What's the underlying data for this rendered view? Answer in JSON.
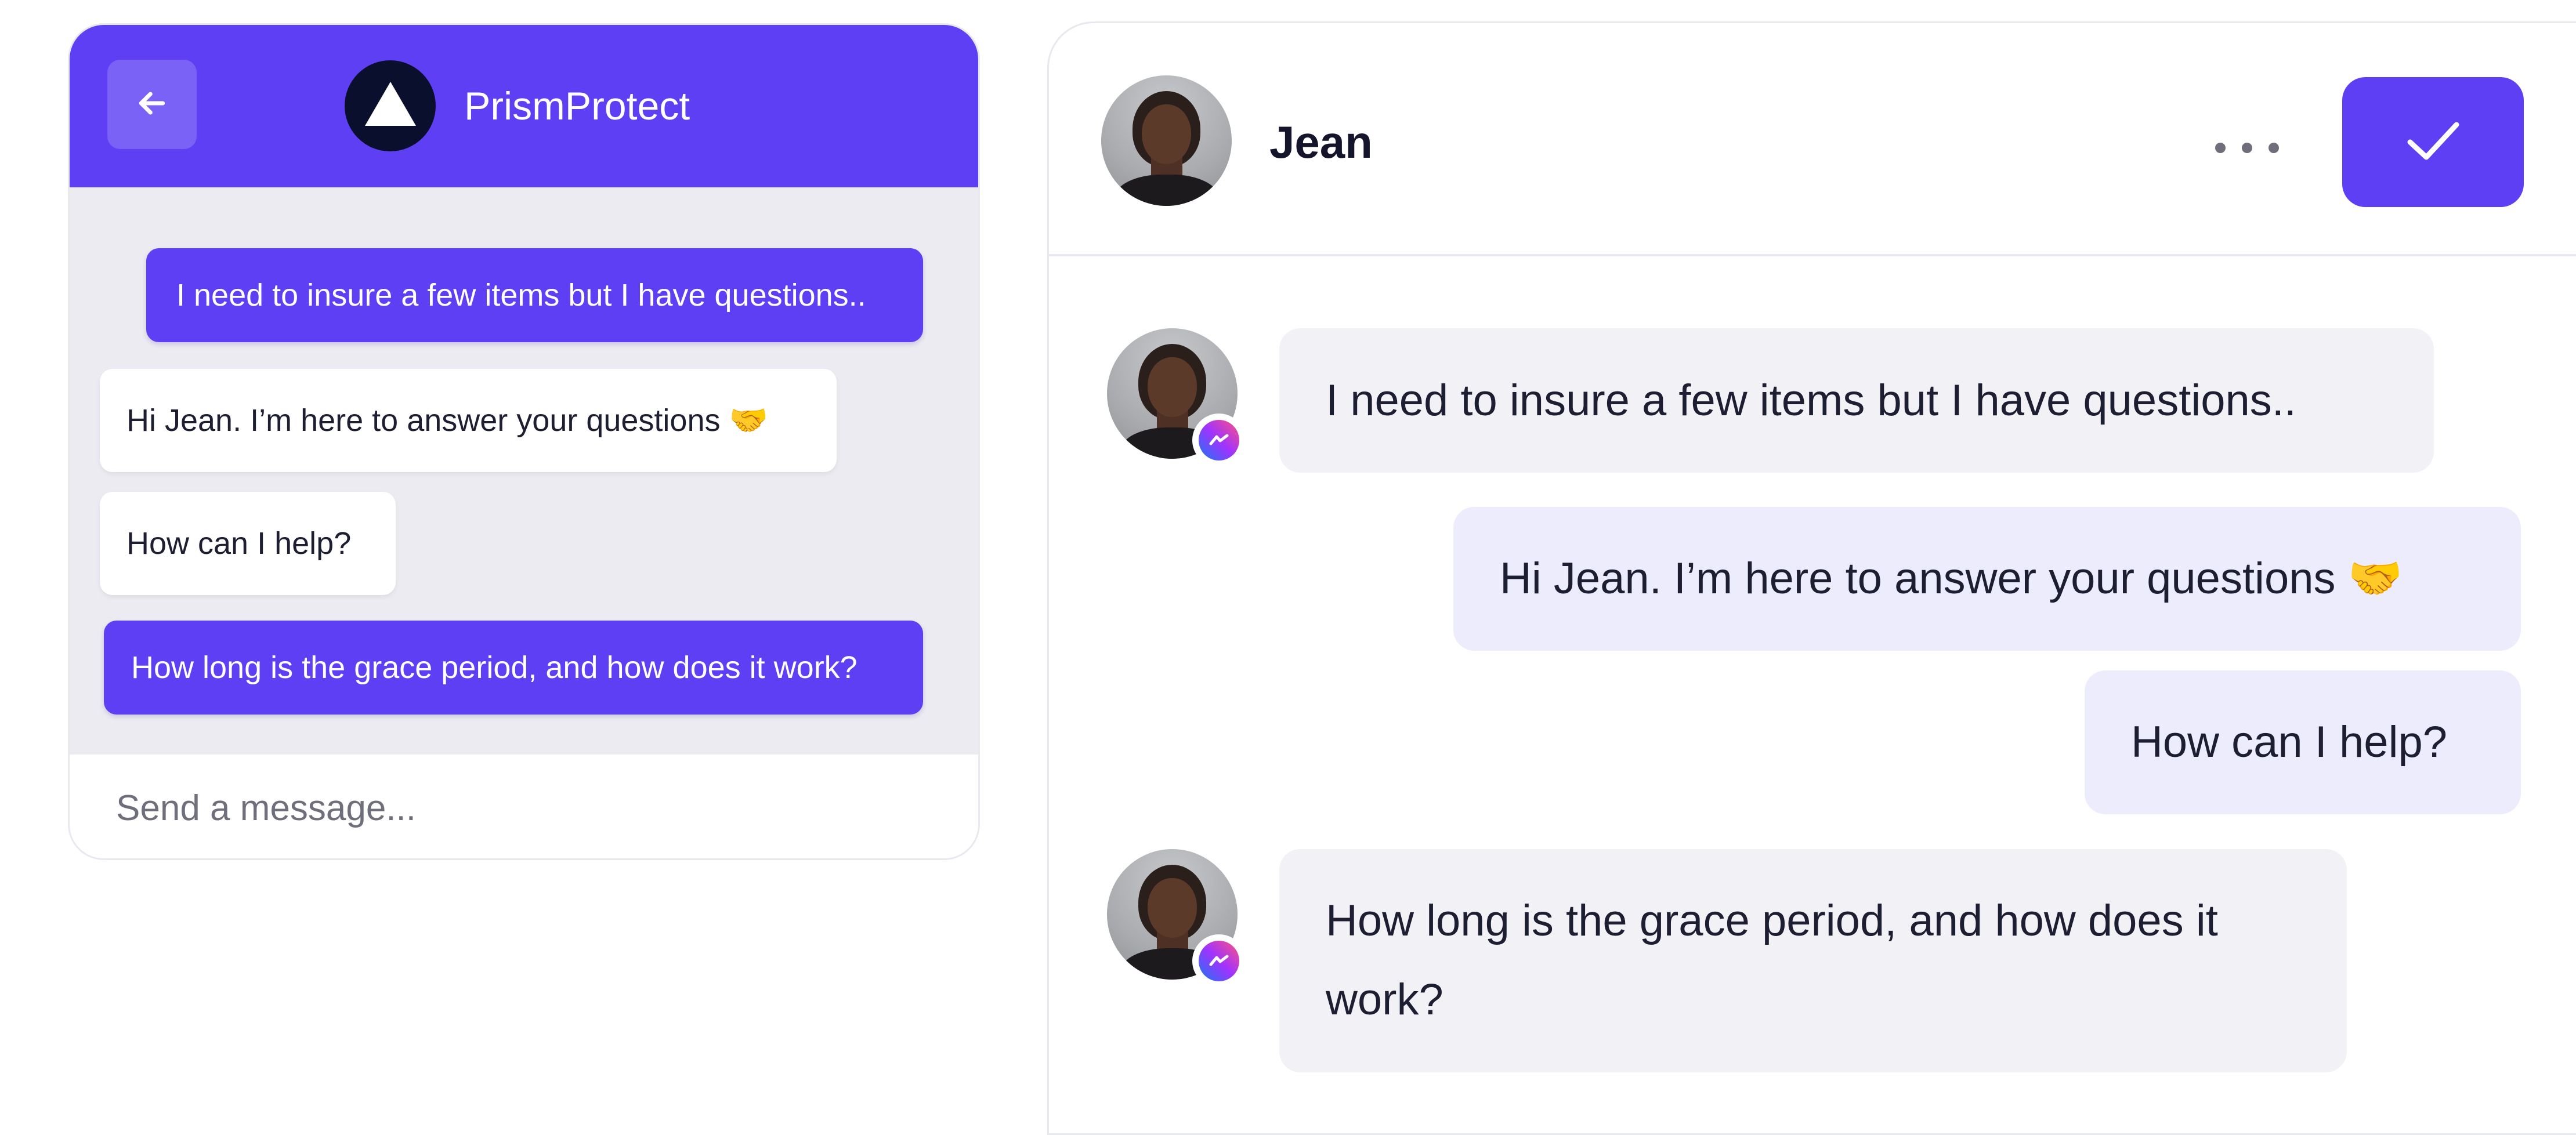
{
  "widget": {
    "brand_name": "PrismProtect",
    "back_icon": "arrow-left-icon",
    "logo_icon": "triangle-logo-icon",
    "messages": [
      {
        "from": "user",
        "text": "I need to insure a few items but I have questions.."
      },
      {
        "from": "agent",
        "text": "Hi Jean. I’m here to answer your questions 🤝"
      },
      {
        "from": "agent",
        "text": "How can I help?"
      },
      {
        "from": "user",
        "text": "How long is the grace period, and how does it work?"
      }
    ],
    "input_placeholder": "Send a message..."
  },
  "panel": {
    "contact_name": "Jean",
    "more_icon": "more-horizontal-icon",
    "confirm_icon": "check-icon",
    "channel_icon": "messenger-icon",
    "messages": [
      {
        "from": "contact",
        "text": "I need to insure a few items but I have questions.."
      },
      {
        "from": "agent",
        "text": "Hi Jean. I’m here to answer your questions 🤝"
      },
      {
        "from": "agent",
        "text": "How can I help?"
      },
      {
        "from": "contact",
        "text": "How long is the grace period, and how does it work?"
      }
    ]
  },
  "colors": {
    "accent": "#5e3ff4",
    "widget_body_bg": "#ebebf1",
    "incoming_bubble_bg": "#f1f1f6",
    "outgoing_bubble_bg": "#ececfd"
  }
}
